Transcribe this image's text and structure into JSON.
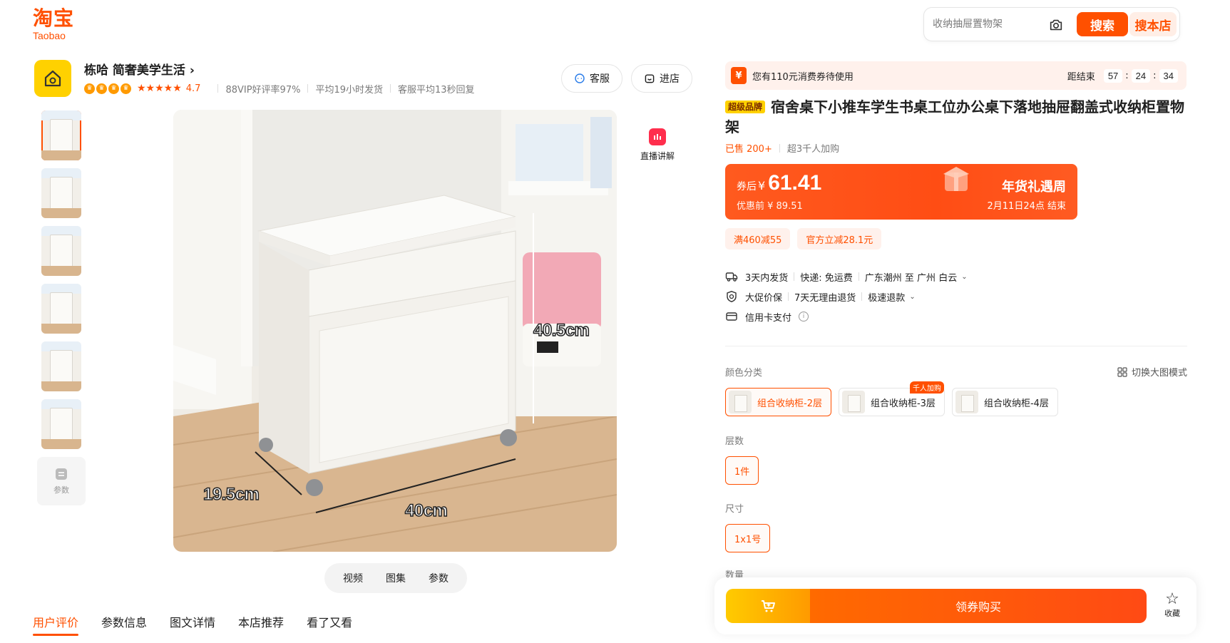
{
  "header": {
    "logo_cn": "淘宝",
    "logo_en": "Taobao",
    "search_placeholder": "收纳抽屉置物架",
    "search_button": "搜索",
    "shop_search_button": "搜本店"
  },
  "store": {
    "name": "栋哈 简奢美学生活",
    "rating": "4.7",
    "vip_rate": "88VIP好评率97%",
    "ship_time": "平均19小时发货",
    "reply_time": "客服平均13秒回复",
    "service_button": "客服",
    "enter_button": "进店"
  },
  "gallery": {
    "params_label": "参数",
    "live_label": "直播讲解",
    "dims": {
      "height": "40.5cm",
      "depth": "19.5cm",
      "width": "40cm"
    },
    "media_tabs": [
      "视频",
      "图集",
      "参数"
    ]
  },
  "bottom_tabs": [
    "用户评价",
    "参数信息",
    "图文详情",
    "本店推荐",
    "看了又看"
  ],
  "coupon": {
    "text": "您有110元消费券待使用",
    "countdown_label": "距结束",
    "hh": "57",
    "mm": "24",
    "ss": "34"
  },
  "product": {
    "tag": "超级品牌",
    "title": "宿舍桌下小推车学生书桌工位办公桌下落地抽屉翻盖式收纳柜置物架",
    "sold": "已售 200+",
    "cart_count": "超3千人加购"
  },
  "price": {
    "after_label": "券后",
    "currency": "¥",
    "after_value": "61.41",
    "before": "优惠前 ¥ 89.51",
    "promo_title": "年货礼遇周",
    "promo_time": "2月11日24点  结束"
  },
  "chips": [
    "满460减55",
    "官方立减28.1元"
  ],
  "services": {
    "ship": "3天内发货",
    "express": "快递: 免运费",
    "route": "广东潮州 至 广州 白云",
    "protect": "大促价保",
    "returns": "7天无理由退货",
    "refund": "极速退款",
    "credit": "信用卡支付"
  },
  "sku": {
    "color_label": "颜色分类",
    "mode_toggle": "切换大图模式",
    "options": [
      "组合收纳柜-2层",
      "组合收纳柜-3层",
      "组合收纳柜-4层"
    ],
    "hot_badge": "千人加购",
    "layer_label": "层数",
    "layer_value": "1件",
    "size_label": "尺寸",
    "size_value": "1x1号",
    "qty_label": "数量"
  },
  "buy": {
    "button": "领券购买",
    "fav": "收藏"
  },
  "colors": {
    "brand": "#ff5000"
  }
}
